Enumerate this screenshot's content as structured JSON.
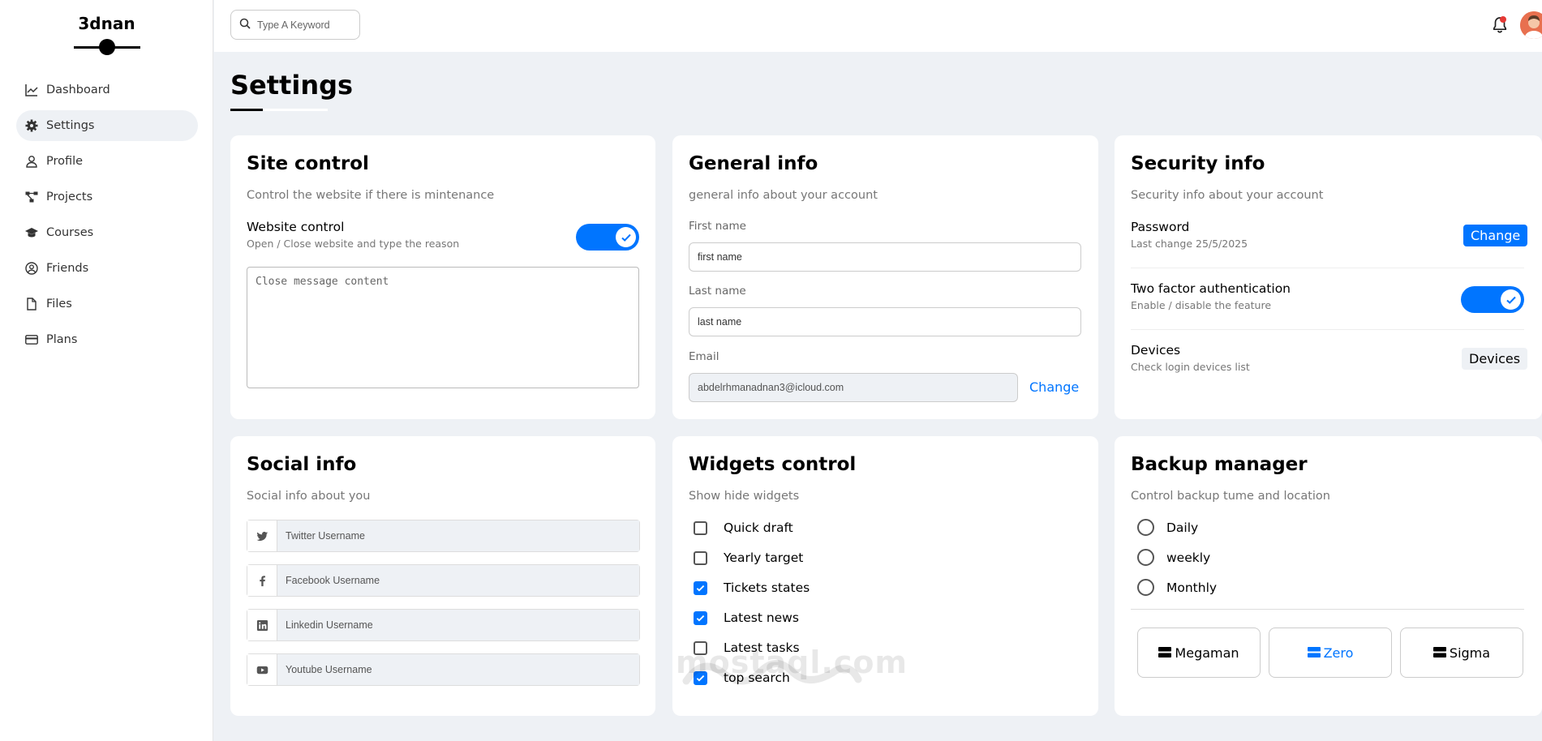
{
  "sidebar": {
    "brand": "3dnan",
    "items": [
      {
        "label": "Dashboard",
        "icon": "chart-line-icon"
      },
      {
        "label": "Settings",
        "icon": "gear-icon",
        "active": true
      },
      {
        "label": "Profile",
        "icon": "user-icon"
      },
      {
        "label": "Projects",
        "icon": "diagram-icon"
      },
      {
        "label": "Courses",
        "icon": "graduation-cap-icon"
      },
      {
        "label": "Friends",
        "icon": "user-circle-icon"
      },
      {
        "label": "Files",
        "icon": "file-icon"
      },
      {
        "label": "Plans",
        "icon": "credit-card-icon"
      }
    ]
  },
  "header": {
    "search_placeholder": "Type A Keyword",
    "accent": "#0075ff",
    "notification_badge_color": "#e53935"
  },
  "page": {
    "title": "Settings"
  },
  "site_control": {
    "title": "Site control",
    "subtitle": "Control the website if there is mintenance",
    "row_title": "Website control",
    "row_sub": "Open / Close website and type the reason",
    "toggle_on": true,
    "textarea_placeholder": "Close message content"
  },
  "general_info": {
    "title": "General info",
    "subtitle": "general info about your account",
    "first_name_label": "First name",
    "first_name_placeholder": "first name",
    "last_name_label": "Last name",
    "last_name_placeholder": "last name",
    "email_label": "Email",
    "email_value": "abdelrhmanadnan3@icloud.com",
    "change_label": "Change"
  },
  "security_info": {
    "title": "Security info",
    "subtitle": "Security info about your account",
    "password_title": "Password",
    "password_sub": "Last change 25/5/2025",
    "password_button": "Change",
    "twofa_title": "Two factor authentication",
    "twofa_sub": "Enable / disable the feature",
    "twofa_on": true,
    "devices_title": "Devices",
    "devices_sub": "Check login devices list",
    "devices_button": "Devices"
  },
  "social_info": {
    "title": "Social info",
    "subtitle": "Social info about you",
    "twitter_placeholder": "Twitter Username",
    "facebook_placeholder": "Facebook Username",
    "linkedin_placeholder": "Linkedin Username",
    "youtube_placeholder": "Youtube Username"
  },
  "widgets_control": {
    "title": "Widgets control",
    "subtitle": "Show hide widgets",
    "items": [
      {
        "label": "Quick draft",
        "checked": false
      },
      {
        "label": "Yearly target",
        "checked": false
      },
      {
        "label": "Tickets states",
        "checked": true
      },
      {
        "label": "Latest news",
        "checked": true
      },
      {
        "label": "Latest tasks",
        "checked": false
      },
      {
        "label": "top search",
        "checked": true
      }
    ]
  },
  "backup_manager": {
    "title": "Backup manager",
    "subtitle": "Control backup tume and location",
    "options": [
      "Daily",
      "weekly",
      "Monthly"
    ],
    "servers": [
      {
        "label": "Megaman",
        "active": false
      },
      {
        "label": "Zero",
        "active": true
      },
      {
        "label": "Sigma",
        "active": false
      }
    ]
  },
  "watermark": {
    "text": "mostaql.com"
  }
}
